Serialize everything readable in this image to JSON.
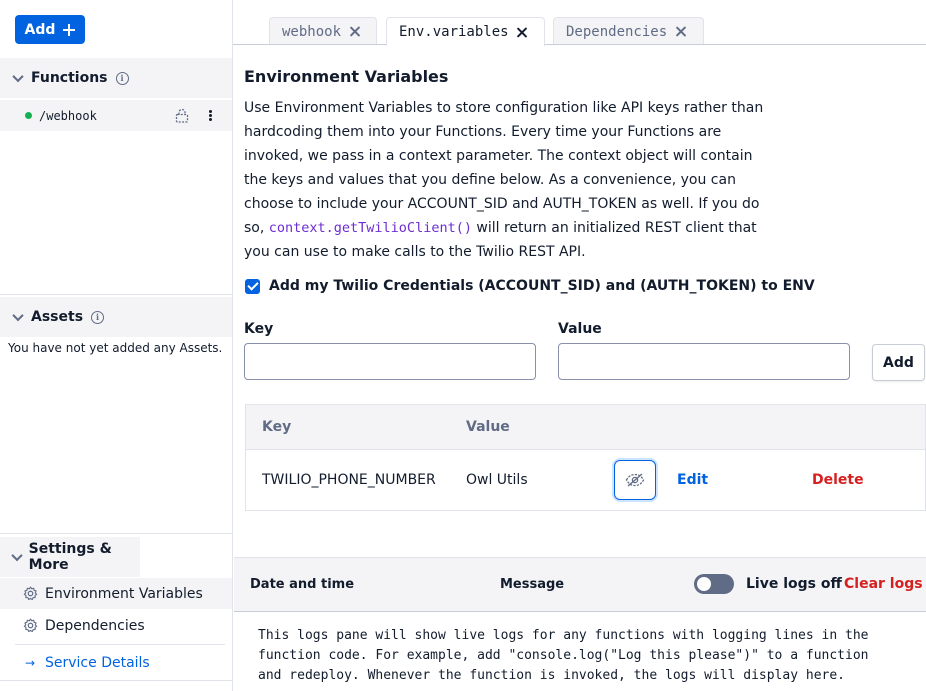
{
  "sidebar": {
    "add_label": "Add",
    "functions": {
      "title": "Functions",
      "items": [
        {
          "name": "/webhook",
          "status_color": "#14b053"
        }
      ]
    },
    "assets": {
      "title": "Assets",
      "empty_text": "You have not yet added any Assets."
    },
    "settings": {
      "title": "Settings & More",
      "items": [
        {
          "label": "Environment Variables",
          "icon": "gear-icon"
        },
        {
          "label": "Dependencies",
          "icon": "gear-icon"
        },
        {
          "label": "Service Details",
          "icon": "arrow-right-icon"
        }
      ]
    }
  },
  "tabs": [
    {
      "label": "webhook",
      "active": false
    },
    {
      "label": "Env.variables",
      "active": true
    },
    {
      "label": "Dependencies",
      "active": false
    }
  ],
  "env": {
    "title": "Environment Variables",
    "desc_before": "Use Environment Variables to store configuration like API keys rather than hardcoding them into your Functions. Every time your Functions are invoked, we pass in a context parameter. The context object will contain the keys and values that you define below. As a convenience, you can choose to include your ACCOUNT_SID and AUTH_TOKEN as well. If you do so, ",
    "desc_code": "context.getTwilioClient()",
    "desc_after": " will return an initialized REST client that you can use to make calls to the Twilio REST API.",
    "credentials_label": "Add my Twilio Credentials (ACCOUNT_SID) and (AUTH_TOKEN) to ENV",
    "credentials_checked": true,
    "key_label": "Key",
    "value_label": "Value",
    "key_value": "",
    "value_value": "",
    "add_label": "Add",
    "table": {
      "headers": {
        "key": "Key",
        "value": "Value"
      },
      "rows": [
        {
          "key": "TWILIO_PHONE_NUMBER",
          "value": "Owl Utils",
          "edit": "Edit",
          "delete": "Delete"
        }
      ]
    }
  },
  "logs": {
    "col_date": "Date and time",
    "col_message": "Message",
    "live_label": "Live logs off",
    "clear_label": "Clear logs",
    "body": "This logs pane will show live logs for any functions with logging lines in the function code. For example, add \"console.log(\"Log this please\")\" to a function and redeploy. Whenever the function is invoked, the logs will display here."
  },
  "colors": {
    "accent": "#0263e0",
    "danger": "#d61f1f",
    "success": "#14b053"
  }
}
